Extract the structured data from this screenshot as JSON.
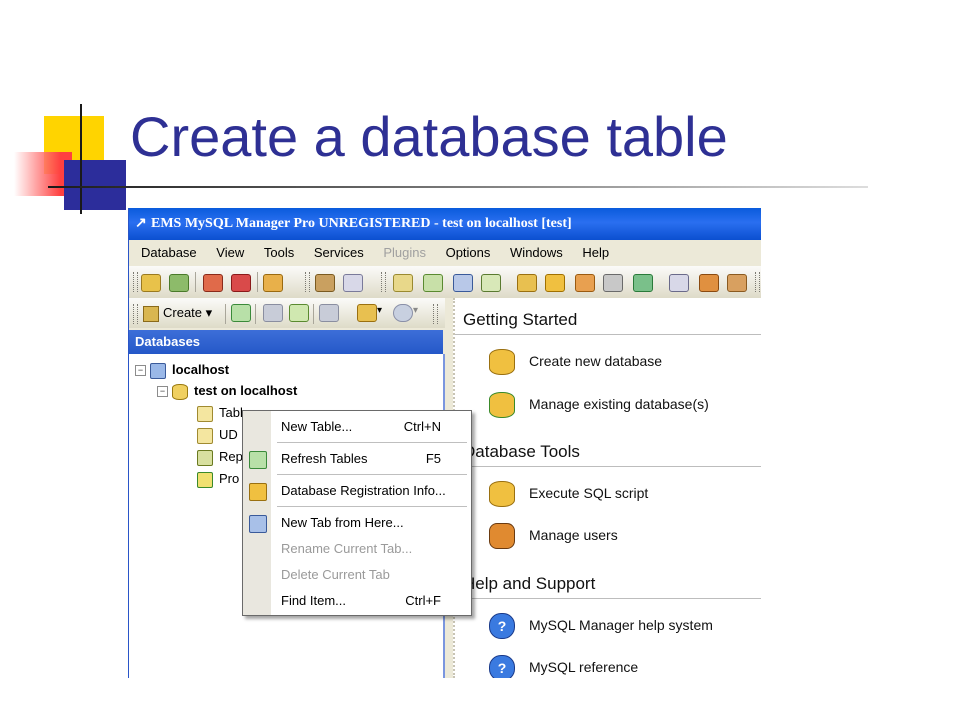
{
  "slide": {
    "title": "Create a database table"
  },
  "window": {
    "title": "EMS MySQL Manager Pro UNREGISTERED - test on localhost [test]",
    "menu": [
      {
        "label": "Database",
        "enabled": true
      },
      {
        "label": "View",
        "enabled": true
      },
      {
        "label": "Tools",
        "enabled": true
      },
      {
        "label": "Services",
        "enabled": true
      },
      {
        "label": "Plugins",
        "enabled": false
      },
      {
        "label": "Options",
        "enabled": true
      },
      {
        "label": "Windows",
        "enabled": true
      },
      {
        "label": "Help",
        "enabled": true
      }
    ]
  },
  "left_panel": {
    "create_label": "Create",
    "header": "Databases",
    "tree": {
      "server": "localhost",
      "database": "test on localhost",
      "items": [
        "Tables",
        "UD",
        "Rep",
        "Pro"
      ]
    }
  },
  "context_menu": {
    "items": [
      {
        "label": "New Table...",
        "shortcut": "Ctrl+N",
        "enabled": true
      },
      {
        "label": "Refresh Tables",
        "shortcut": "F5",
        "enabled": true
      },
      {
        "label": "Database Registration Info...",
        "shortcut": "",
        "enabled": true
      },
      {
        "label": "New Tab from Here...",
        "shortcut": "",
        "enabled": true
      },
      {
        "label": "Rename Current Tab...",
        "shortcut": "",
        "enabled": false
      },
      {
        "label": "Delete Current Tab",
        "shortcut": "",
        "enabled": false
      },
      {
        "label": "Find Item...",
        "shortcut": "Ctrl+F",
        "enabled": true
      }
    ]
  },
  "right_panel": {
    "sections": [
      {
        "title": "Getting Started",
        "links": [
          "Create new database",
          "Manage existing database(s)"
        ]
      },
      {
        "title": "Database Tools",
        "links": [
          "Execute SQL script",
          "Manage users"
        ]
      },
      {
        "title": "Help and Support",
        "links": [
          "MySQL Manager help system",
          "MySQL reference"
        ]
      }
    ]
  },
  "colors": {
    "slide_title": "#2e3094",
    "titlebar": "#0a5bdc",
    "panel_header": "#2458c8"
  }
}
